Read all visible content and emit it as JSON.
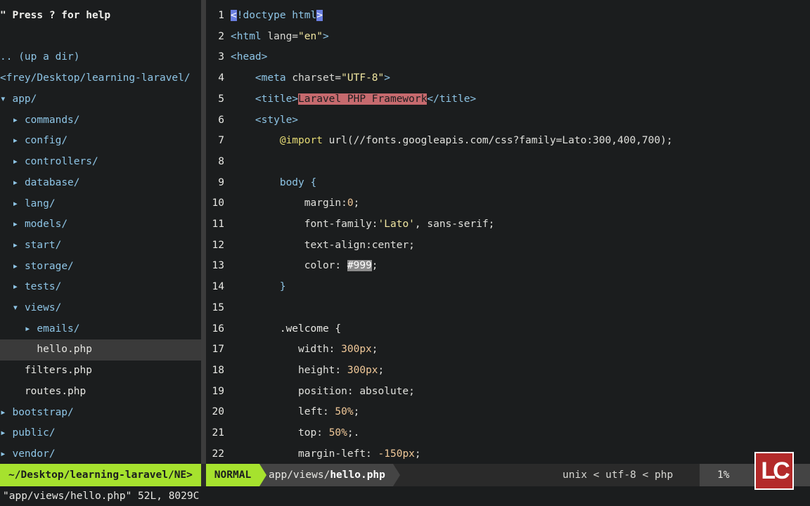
{
  "sidebar": {
    "help": "\" Press ? for help",
    "up_dir": ".. (up a dir)",
    "root_path": "<frey/Desktop/learning-laravel/",
    "arrow_open": "▾",
    "arrow_closed": "▸",
    "items": [
      {
        "label": "app/",
        "type": "dir",
        "open": true,
        "depth": 0
      },
      {
        "label": "commands/",
        "type": "dir",
        "open": false,
        "depth": 1
      },
      {
        "label": "config/",
        "type": "dir",
        "open": false,
        "depth": 1
      },
      {
        "label": "controllers/",
        "type": "dir",
        "open": false,
        "depth": 1
      },
      {
        "label": "database/",
        "type": "dir",
        "open": false,
        "depth": 1
      },
      {
        "label": "lang/",
        "type": "dir",
        "open": false,
        "depth": 1
      },
      {
        "label": "models/",
        "type": "dir",
        "open": false,
        "depth": 1
      },
      {
        "label": "start/",
        "type": "dir",
        "open": false,
        "depth": 1
      },
      {
        "label": "storage/",
        "type": "dir",
        "open": false,
        "depth": 1
      },
      {
        "label": "tests/",
        "type": "dir",
        "open": false,
        "depth": 1
      },
      {
        "label": "views/",
        "type": "dir",
        "open": true,
        "depth": 1
      },
      {
        "label": "emails/",
        "type": "dir",
        "open": false,
        "depth": 2
      },
      {
        "label": "hello.php",
        "type": "file",
        "depth": 2,
        "selected": true
      },
      {
        "label": "filters.php",
        "type": "file",
        "depth": 1
      },
      {
        "label": "routes.php",
        "type": "file",
        "depth": 1
      },
      {
        "label": "bootstrap/",
        "type": "dir",
        "open": false,
        "depth": 0
      },
      {
        "label": "public/",
        "type": "dir",
        "open": false,
        "depth": 0
      },
      {
        "label": "vendor/",
        "type": "dir",
        "open": false,
        "depth": 0
      }
    ]
  },
  "editor": {
    "lines": [
      {
        "n": "1",
        "parts": [
          {
            "t": "<",
            "c": "match"
          },
          {
            "t": "!doctype html",
            "c": "tag"
          },
          {
            "t": ">",
            "c": "match"
          }
        ]
      },
      {
        "n": "2",
        "parts": [
          {
            "t": "<html ",
            "c": "tag"
          },
          {
            "t": "lang=",
            "c": "attr"
          },
          {
            "t": "\"en\"",
            "c": "str"
          },
          {
            "t": ">",
            "c": "tag"
          }
        ]
      },
      {
        "n": "3",
        "parts": [
          {
            "t": "<head>",
            "c": "tag"
          }
        ]
      },
      {
        "n": "4",
        "parts": [
          {
            "t": "    ",
            "c": ""
          },
          {
            "t": "<meta ",
            "c": "tag"
          },
          {
            "t": "charset=",
            "c": "attr"
          },
          {
            "t": "\"UTF-8\"",
            "c": "str"
          },
          {
            "t": ">",
            "c": "tag"
          }
        ]
      },
      {
        "n": "5",
        "parts": [
          {
            "t": "    ",
            "c": ""
          },
          {
            "t": "<title>",
            "c": "tag"
          },
          {
            "t": "Laravel PHP Framework",
            "c": "hl-title"
          },
          {
            "t": "</title>",
            "c": "tag"
          }
        ]
      },
      {
        "n": "6",
        "parts": [
          {
            "t": "    ",
            "c": ""
          },
          {
            "t": "<style>",
            "c": "tag"
          }
        ]
      },
      {
        "n": "7",
        "parts": [
          {
            "t": "        ",
            "c": ""
          },
          {
            "t": "@import",
            "c": "at"
          },
          {
            "t": " url(//fonts.googleapis.com/css?family=Lato:300,400,700);",
            "c": "prop"
          }
        ]
      },
      {
        "n": "8",
        "parts": []
      },
      {
        "n": "9",
        "parts": [
          {
            "t": "        ",
            "c": ""
          },
          {
            "t": "body {",
            "c": "tag"
          }
        ]
      },
      {
        "n": "10",
        "parts": [
          {
            "t": "            ",
            "c": ""
          },
          {
            "t": "margin:",
            "c": "prop"
          },
          {
            "t": "0",
            "c": "num"
          },
          {
            "t": ";",
            "c": "prop"
          }
        ]
      },
      {
        "n": "11",
        "parts": [
          {
            "t": "            ",
            "c": ""
          },
          {
            "t": "font-family:",
            "c": "prop"
          },
          {
            "t": "'Lato'",
            "c": "str"
          },
          {
            "t": ", sans-serif;",
            "c": "prop"
          }
        ]
      },
      {
        "n": "12",
        "parts": [
          {
            "t": "            ",
            "c": ""
          },
          {
            "t": "text-align:center;",
            "c": "prop"
          }
        ]
      },
      {
        "n": "13",
        "parts": [
          {
            "t": "            ",
            "c": ""
          },
          {
            "t": "color: ",
            "c": "prop"
          },
          {
            "t": "#999",
            "c": "hl-hex"
          },
          {
            "t": ";",
            "c": "prop"
          }
        ]
      },
      {
        "n": "14",
        "parts": [
          {
            "t": "        ",
            "c": ""
          },
          {
            "t": "}",
            "c": "tag"
          }
        ]
      },
      {
        "n": "15",
        "parts": []
      },
      {
        "n": "16",
        "parts": [
          {
            "t": "        ",
            "c": ""
          },
          {
            "t": ".welcome {",
            "c": "sel"
          }
        ]
      },
      {
        "n": "17",
        "parts": [
          {
            "t": "           ",
            "c": ""
          },
          {
            "t": "width: ",
            "c": "prop"
          },
          {
            "t": "300px",
            "c": "num"
          },
          {
            "t": ";",
            "c": "prop"
          }
        ]
      },
      {
        "n": "18",
        "parts": [
          {
            "t": "           ",
            "c": ""
          },
          {
            "t": "height: ",
            "c": "prop"
          },
          {
            "t": "300px",
            "c": "num"
          },
          {
            "t": ";",
            "c": "prop"
          }
        ]
      },
      {
        "n": "19",
        "parts": [
          {
            "t": "           ",
            "c": ""
          },
          {
            "t": "position: absolute;",
            "c": "prop"
          }
        ]
      },
      {
        "n": "20",
        "parts": [
          {
            "t": "           ",
            "c": ""
          },
          {
            "t": "left: ",
            "c": "prop"
          },
          {
            "t": "50%",
            "c": "num"
          },
          {
            "t": ";",
            "c": "prop"
          }
        ]
      },
      {
        "n": "21",
        "parts": [
          {
            "t": "           ",
            "c": ""
          },
          {
            "t": "top: ",
            "c": "prop"
          },
          {
            "t": "50%",
            "c": "num"
          },
          {
            "t": ";.",
            "c": "prop"
          }
        ]
      },
      {
        "n": "22",
        "parts": [
          {
            "t": "           ",
            "c": ""
          },
          {
            "t": "margin-left: ",
            "c": "prop"
          },
          {
            "t": "-150px",
            "c": "num"
          },
          {
            "t": ";",
            "c": "prop"
          }
        ]
      }
    ]
  },
  "statusline": {
    "left_path": "~/Desktop/learning-laravel/NE>",
    "mode": "NORMAL",
    "file_dir": "app/views/",
    "file_name": "hello.php",
    "format": "unix",
    "sep": "<",
    "encoding": "utf-8",
    "filetype": "php",
    "percent": "1%"
  },
  "cmdline": {
    "message": "\"app/views/hello.php\" 52L, 8029C"
  },
  "logo": {
    "text": "LC"
  }
}
